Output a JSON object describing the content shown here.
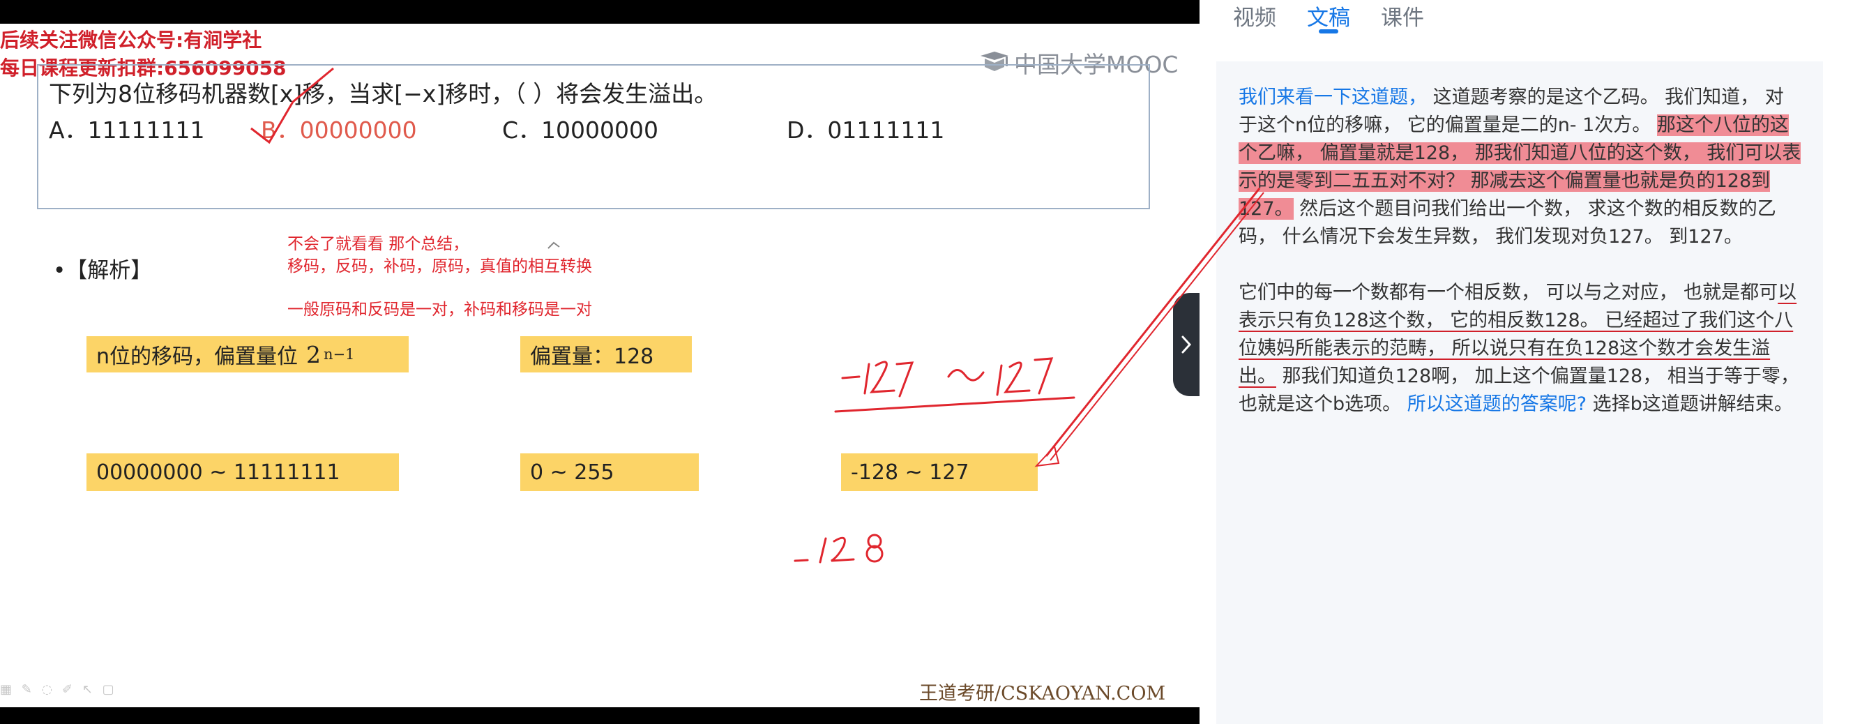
{
  "video": {
    "banner_line1": "后续关注微信公众号:有涧学社",
    "banner_line2": "每日课程更新扣群:656099058",
    "logo_text": "中国大学MOOC",
    "question": "下列为8位移码机器数[x]移，当求[−x]移时，（    ）将会发生溢出。",
    "options": {
      "a": "A．11111111",
      "b": "B．00000000",
      "c": "C．10000000",
      "d": "D．01111111"
    },
    "analysis_heading": "•【解析】",
    "notes": [
      "不会了就看看  那个总结，",
      "移码，反码，补码，原码，真值的相互转换",
      "一般原码和反码是一对，补码和移码是一对"
    ],
    "boxes": {
      "excess": "n位的移码，偏置量位",
      "excess_base": "2",
      "excess_exp": "n−1",
      "bias": "偏置量：128",
      "range_binary": "00000000    ~    11111111",
      "range_decimal": "0    ~    255",
      "range_signed": "-128    ~    127"
    },
    "handwriting": {
      "range": "-127 ~ 127",
      "minus128": "-128"
    },
    "watermark": "王道考研/CSKAOYAN.COM",
    "player_icons": "▦ ✎ ◌ ✐ ↖ ▢"
  },
  "tabs": [
    {
      "label": "视频",
      "active": false
    },
    {
      "label": "文稿",
      "active": true
    },
    {
      "label": "课件",
      "active": false
    }
  ],
  "transcript": {
    "p1": [
      {
        "text": "我们来看一下这道题，",
        "style": "link"
      },
      {
        "text": " 这道题考察的是这个乙码。 我们知道，  对于这个n位的移嘛，  它的偏置量是二的n- 1次方。 ",
        "style": "plain"
      },
      {
        "text": "那这个八位的这个乙嘛，  偏置量就是128，  那我们知道八位的这个数，  我们可以表示的是零到二五五对不对？ 那减去这个偏置量也就是负的128到127。",
        "style": "highlight"
      },
      {
        "text": " 然后这个题目问我们给出一个数，  求这个数的相反数的乙码，  什么情况下会发生异数，  我们发现对负127。 到127。",
        "style": "plain"
      }
    ],
    "p2": [
      {
        "text": "它们中的每一个数都有一个相反数，  可以与之对应，  也就是都可",
        "style": "plain"
      },
      {
        "text": "以表示只有负128这个数，  它的相反数128。 已经超过了我们这个八位姨妈所能表示的范畴，  所以说只有在负128这个数才会发生溢出。",
        "style": "underline"
      },
      {
        "text": " 那我们知道负128啊，  加上这个偏置量128，  相当于等于零，  也就是这个b选项。 ",
        "style": "plain"
      },
      {
        "text": "所以这道题的答案呢?",
        "style": "link"
      },
      {
        "text": " 选择b这道题讲解结束。",
        "style": "plain"
      }
    ]
  },
  "colors": {
    "accent": "#1677e6",
    "highlight": "#f08c95",
    "annotation_red": "#e0262e",
    "box_yellow": "#fcd467"
  }
}
